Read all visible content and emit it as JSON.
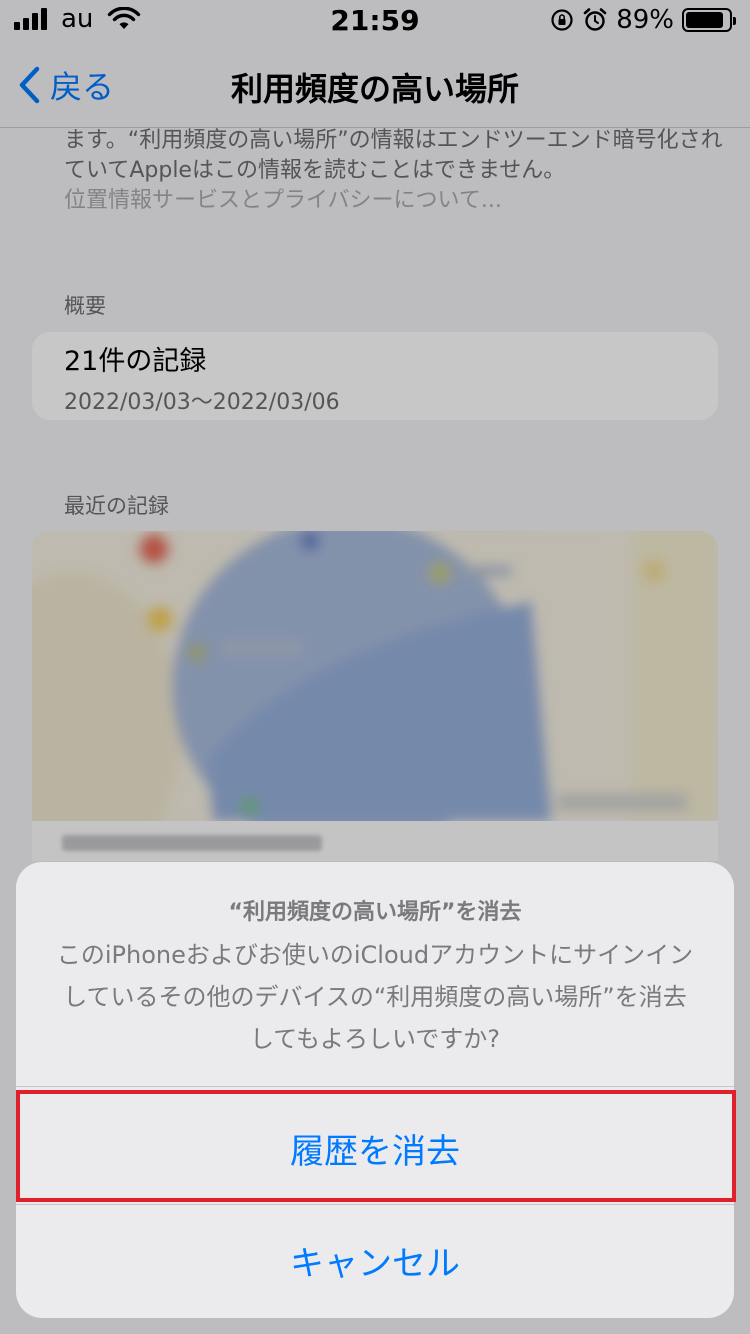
{
  "status_bar": {
    "carrier": "au",
    "time": "21:59",
    "battery_percent": "89%",
    "battery_level": 0.89,
    "icons": [
      "signal-icon",
      "wifi-icon",
      "rotation-lock-icon",
      "alarm-icon",
      "battery-icon"
    ]
  },
  "nav": {
    "back_label": "戻る",
    "title": "利用頻度の高い場所"
  },
  "description": {
    "line1": "ます。“利用頻度の高い場所”の情報はエンドツーエンド暗号化され",
    "line2": "ていてAppleはこの情報を読むことはできません。",
    "link": "位置情報サービスとプライバシーについて..."
  },
  "summary": {
    "header": "概要",
    "count": "21件の記録",
    "range": "2022/03/03〜2022/03/06"
  },
  "recent": {
    "header": "最近の記録"
  },
  "action_sheet": {
    "title": "“利用頻度の高い場所”を消去",
    "message": "このiPhoneおよびお使いのiCloudアカウントにサインインしているその他のデバイスの“利用頻度の高い場所”を消去してもよろしいですか?",
    "clear_label": "履歴を消去",
    "cancel_label": "キャンセル"
  },
  "colors": {
    "accent": "#007aff",
    "highlight": "#e0212b"
  }
}
